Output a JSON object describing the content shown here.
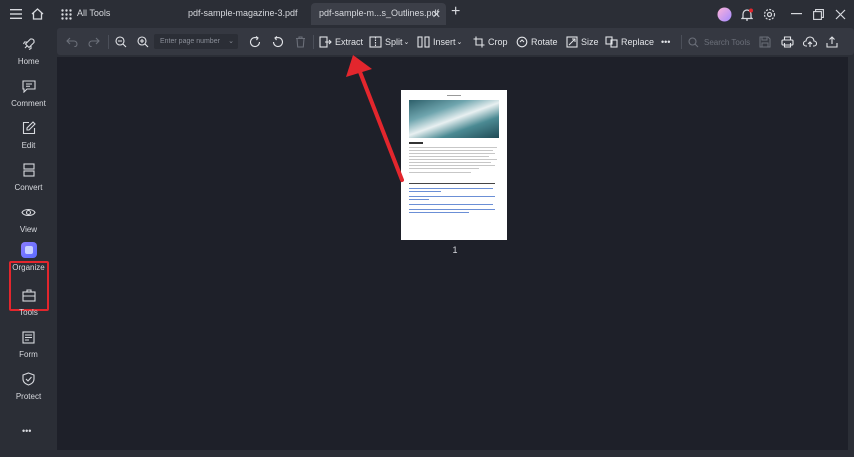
{
  "titlebar": {
    "all_tools": "All Tools",
    "tab1": "pdf-sample-magazine-3.pdf",
    "tab2": "pdf-sample-m...s_Outlines.pdf",
    "tab_close": "✕",
    "new_tab": "+"
  },
  "sidebar": {
    "items": [
      {
        "label": "Home",
        "icon": "rocket-icon"
      },
      {
        "label": "Comment",
        "icon": "comment-icon"
      },
      {
        "label": "Edit",
        "icon": "edit-icon"
      },
      {
        "label": "Convert",
        "icon": "convert-icon"
      },
      {
        "label": "View",
        "icon": "eye-icon"
      },
      {
        "label": "Organize",
        "icon": "organize-icon"
      },
      {
        "label": "Tools",
        "icon": "toolbox-icon"
      },
      {
        "label": "Form",
        "icon": "form-icon"
      },
      {
        "label": "Protect",
        "icon": "shield-icon"
      }
    ],
    "more": "•••"
  },
  "toolbar": {
    "page_placeholder": "Enter page number",
    "extract": "Extract",
    "split": "Split",
    "insert": "Insert",
    "crop": "Crop",
    "rotate": "Rotate",
    "size": "Size",
    "replace": "Replace",
    "more": "•••",
    "search_tools": "Search Tools"
  },
  "document": {
    "page_number": "1"
  },
  "colors": {
    "highlight": "#e3262d",
    "accent": "#6b7cff"
  }
}
